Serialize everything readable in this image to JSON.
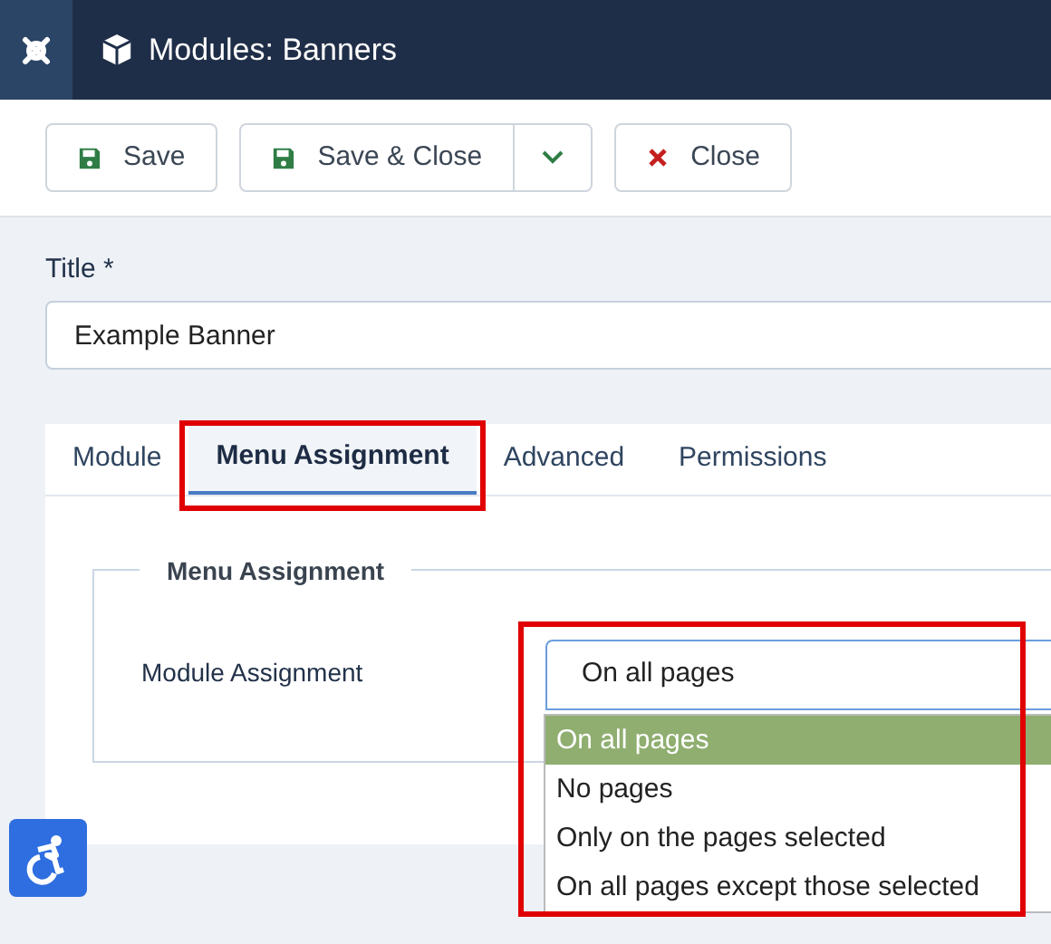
{
  "header": {
    "title": "Modules: Banners"
  },
  "toolbar": [
    {
      "kind": "save",
      "label": "Save"
    },
    {
      "kind": "save",
      "label": "Save & Close",
      "dropdown": true
    },
    {
      "kind": "close",
      "label": "Close"
    }
  ],
  "title_field": {
    "label": "Title *",
    "value": "Example Banner"
  },
  "tabs": [
    {
      "label": "Module",
      "selected": false,
      "highlighted": false
    },
    {
      "label": "Menu Assignment",
      "selected": true,
      "highlighted": true
    },
    {
      "label": "Advanced",
      "selected": false,
      "highlighted": false
    },
    {
      "label": "Permissions",
      "selected": false,
      "highlighted": false
    }
  ],
  "fieldset": {
    "legend": "Menu Assignment",
    "label": "Module Assignment",
    "value": "On all pages",
    "expanded": true,
    "highlighted": true,
    "options": [
      {
        "label": "On all pages",
        "selected": true
      },
      {
        "label": "No pages",
        "selected": false
      },
      {
        "label": "Only on the pages selected",
        "selected": false
      },
      {
        "label": "On all pages except those selected",
        "selected": false
      }
    ]
  }
}
